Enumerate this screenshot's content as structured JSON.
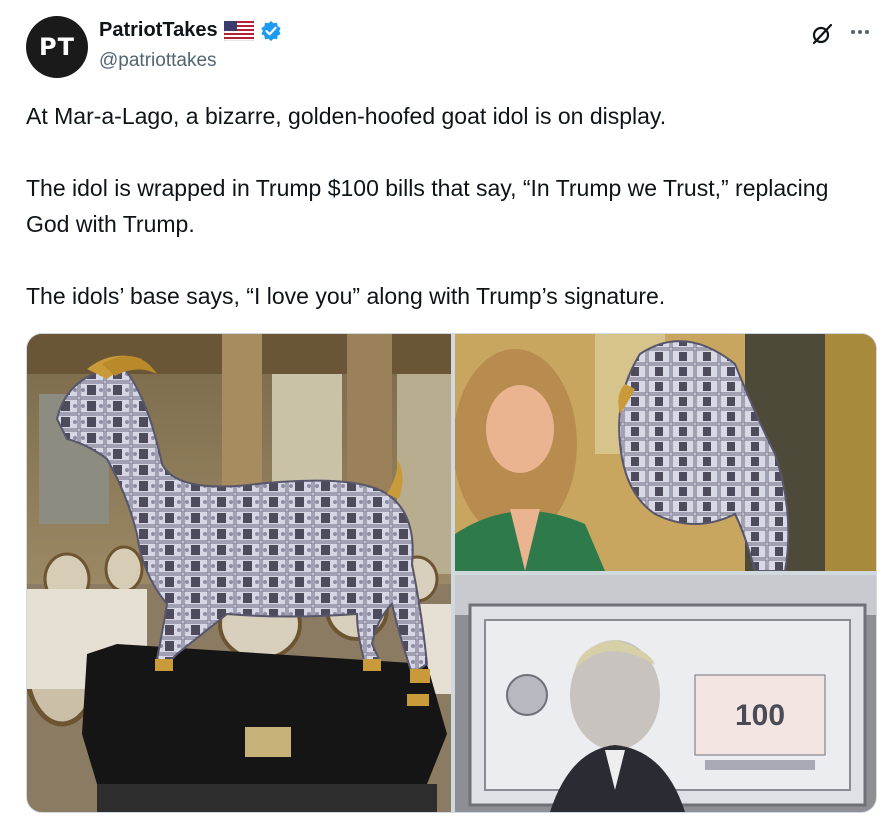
{
  "author": {
    "avatar_text": "PT",
    "display_name": "PatriotTakes",
    "handle": "@patriottakes",
    "flag_icon": "us-flag-icon",
    "verified_icon": "verified-badge-icon",
    "verified_color": "#1d9bf0"
  },
  "header_actions": {
    "grok_icon": "grok-icon",
    "more_icon": "more-icon"
  },
  "tweet": {
    "text": "At Mar-a-Lago, a bizarre, golden-hoofed goat idol is on display.\n\nThe idol is wrapped in Trump $100 bills that say, “In Trump we Trust,” replacing God with Trump.\n\nThe idols’ base says, “I love you” along with Trump’s signature."
  },
  "media": {
    "images": [
      {
        "alt": "goat idol photo",
        "subject": "goat-statue"
      },
      {
        "alt": "woman posing with goat idol photo",
        "subject": "woman-with-goat"
      },
      {
        "alt": "close-up of Trump $100 bill photo",
        "subject": "bill-closeup"
      }
    ],
    "bill_text": "100"
  }
}
